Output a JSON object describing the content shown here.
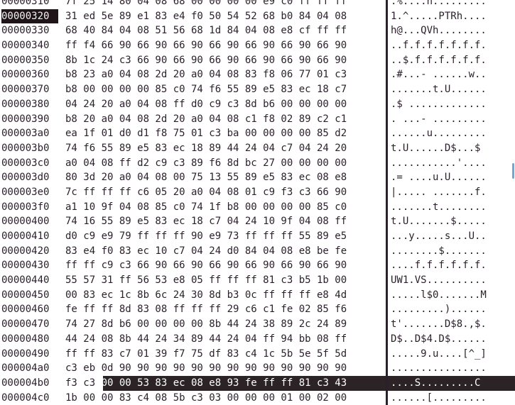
{
  "rows": [
    {
      "addr": "00000310",
      "hex": "7f 25 14 80 04 08 68 00 00 00 00 e9 c0 ff ff ff",
      "ascii": ".%....h........."
    },
    {
      "addr": "00000320",
      "hex": "31 ed 5e 89 e1 83 e4 f0 50 54 52 68 b0 84 04 08",
      "ascii": "1.^.....PTRh...."
    },
    {
      "addr": "00000330",
      "hex": "68 40 84 04 08 51 56 68 1d 84 04 08 e8 cf ff ff",
      "ascii": "h@...QVh........"
    },
    {
      "addr": "00000340",
      "hex": "ff f4 66 90 66 90 66 90 66 90 66 90 66 90 66 90",
      "ascii": "..f.f.f.f.f.f.f."
    },
    {
      "addr": "00000350",
      "hex": "8b 1c 24 c3 66 90 66 90 66 90 66 90 66 90 66 90",
      "ascii": "..$.f.f.f.f.f.f."
    },
    {
      "addr": "00000360",
      "hex": "b8 23 a0 04 08 2d 20 a0 04 08 83 f8 06 77 01 c3",
      "ascii": ".#...- ......w.."
    },
    {
      "addr": "00000370",
      "hex": "b8 00 00 00 00 85 c0 74 f6 55 89 e5 83 ec 18 c7",
      "ascii": ".......t.U......"
    },
    {
      "addr": "00000380",
      "hex": "04 24 20 a0 04 08 ff d0 c9 c3 8d b6 00 00 00 00",
      "ascii": ".$ ............."
    },
    {
      "addr": "00000390",
      "hex": "b8 20 a0 04 08 2d 20 a0 04 08 c1 f8 02 89 c2 c1",
      "ascii": ". ...- ........."
    },
    {
      "addr": "000003a0",
      "hex": "ea 1f 01 d0 d1 f8 75 01 c3 ba 00 00 00 00 85 d2",
      "ascii": "......u........."
    },
    {
      "addr": "000003b0",
      "hex": "74 f6 55 89 e5 83 ec 18 89 44 24 04 c7 04 24 20",
      "ascii": "t.U......D$...$ "
    },
    {
      "addr": "000003c0",
      "hex": "a0 04 08 ff d2 c9 c3 89 f6 8d bc 27 00 00 00 00",
      "ascii": "...........'...."
    },
    {
      "addr": "000003d0",
      "hex": "80 3d 20 a0 04 08 00 75 13 55 89 e5 83 ec 08 e8",
      "ascii": ".= ....u.U......"
    },
    {
      "addr": "000003e0",
      "hex": "7c ff ff ff c6 05 20 a0 04 08 01 c9 f3 c3 66 90",
      "ascii": "|..... .......f."
    },
    {
      "addr": "000003f0",
      "hex": "a1 10 9f 04 08 85 c0 74 1f b8 00 00 00 00 85 c0",
      "ascii": ".......t........"
    },
    {
      "addr": "00000400",
      "hex": "74 16 55 89 e5 83 ec 18 c7 04 24 10 9f 04 08 ff",
      "ascii": "t.U.......$....."
    },
    {
      "addr": "00000410",
      "hex": "d0 c9 e9 79 ff ff ff 90 e9 73 ff ff ff 55 89 e5",
      "ascii": "...y.....s...U.."
    },
    {
      "addr": "00000420",
      "hex": "83 e4 f0 83 ec 10 c7 04 24 d0 84 04 08 e8 be fe",
      "ascii": "........$......."
    },
    {
      "addr": "00000430",
      "hex": "ff ff c9 c3 66 90 66 90 66 90 66 90 66 90 66 90",
      "ascii": "....f.f.f.f.f.f."
    },
    {
      "addr": "00000440",
      "hex": "55 57 31 ff 56 53 e8 05 ff ff ff 81 c3 b5 1b 00",
      "ascii": "UW1.VS.........."
    },
    {
      "addr": "00000450",
      "hex": "00 83 ec 1c 8b 6c 24 30 8d b3 0c ff ff ff e8 4d",
      "ascii": ".....l$0.......M"
    },
    {
      "addr": "00000460",
      "hex": "fe ff ff 8d 83 08 ff ff ff 29 c6 c1 fe 02 85 f6",
      "ascii": ".........)......"
    },
    {
      "addr": "00000470",
      "hex": "74 27 8d b6 00 00 00 00 8b 44 24 38 89 2c 24 89",
      "ascii": "t'.......D$8.,$."
    },
    {
      "addr": "00000480",
      "hex": "44 24 08 8b 44 24 34 89 44 24 04 ff 94 bb 08 ff",
      "ascii": "D$..D$4.D$......"
    },
    {
      "addr": "00000490",
      "hex": "ff ff 83 c7 01 39 f7 75 df 83 c4 1c 5b 5e 5f 5d",
      "ascii": ".....9.u....[^_]"
    },
    {
      "addr": "000004a0",
      "hex": "c3 eb 0d 90 90 90 90 90 90 90 90 90 90 90 90 90",
      "ascii": "................"
    },
    {
      "addr": "000004b0",
      "hex_a": "f3 c3 ",
      "hex_b": "00 00 53 83 ec 08 e8 93 fe ff ff 81 c3 43",
      "ascii_a": "..",
      "ascii_b": "..S.........C"
    },
    {
      "addr": "000004c0",
      "hex": "1b 00 00 83 c4 08 5b c3 03 00 00 00 01 00 02 00",
      "ascii": "......[........."
    }
  ],
  "cursor_addr": "00000320"
}
